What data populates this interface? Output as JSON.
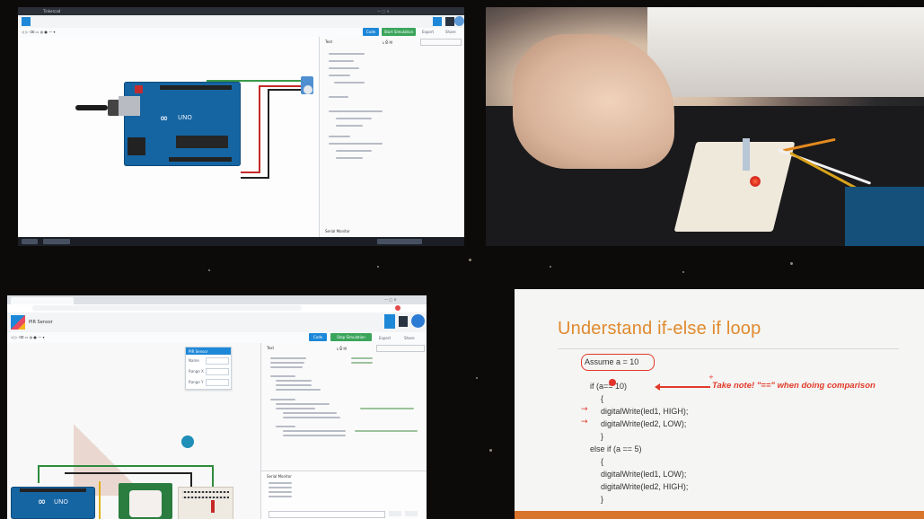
{
  "top_left_window": {
    "title": "Tinkercad",
    "buttons": {
      "code": "Code",
      "simulation": "Start Simulation"
    },
    "panel_title": "Text",
    "serial_monitor": "Serial Monitor",
    "accent": "#1e88d8",
    "board_label": "UNO"
  },
  "bottom_left_window": {
    "title": "PIR Sensor",
    "buttons": {
      "code": "Code",
      "simulation": "Stop Simulation"
    },
    "panel_title": "Text",
    "serial_monitor": "Serial Monitor",
    "sensor_popup": {
      "title": "PIR Sensor",
      "rows": [
        "Name",
        "Range X",
        "Range Y"
      ]
    },
    "board_label": "UNO"
  },
  "slide": {
    "title": "Understand if-else if loop",
    "assume": "Assume a = 10",
    "lines": [
      "if (a== 10)",
      "{",
      "digitalWrite(led1, HIGH);",
      "digitalWrite(led2, LOW);",
      "}",
      "else if (a == 5)",
      "{",
      "digitalWrite(led1, LOW);",
      "digitalWrite(led2, HIGH);",
      "}"
    ],
    "note": "Take note! \"==\" when doing comparison",
    "title_color": "#e08a2e",
    "note_color": "#e23a2a",
    "footer_color": "#d9752b"
  }
}
